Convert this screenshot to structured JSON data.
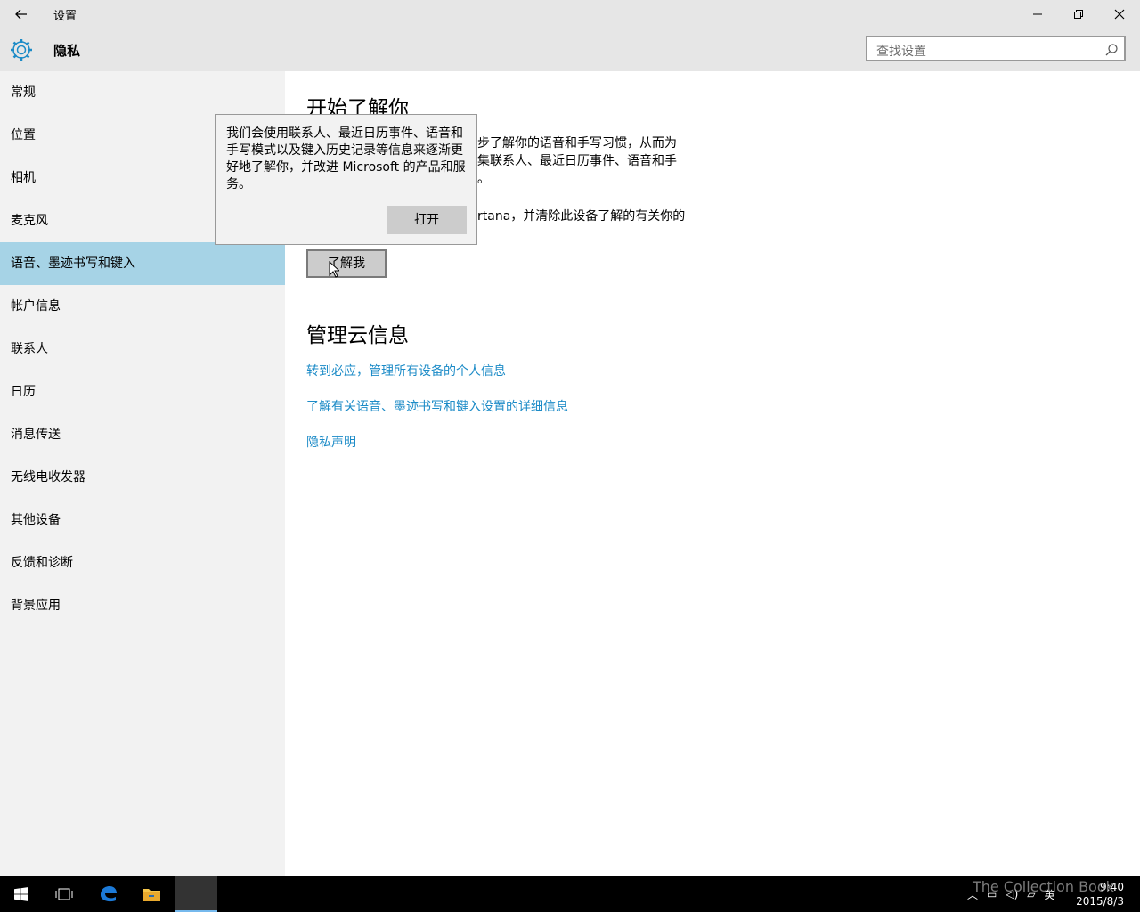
{
  "window": {
    "title": "设置",
    "header_title": "隐私",
    "search_placeholder": "查找设置"
  },
  "sidebar": {
    "items": [
      {
        "label": "常规"
      },
      {
        "label": "位置"
      },
      {
        "label": "相机"
      },
      {
        "label": "麦克风"
      },
      {
        "label": "语音、墨迹书写和键入",
        "active": true
      },
      {
        "label": "帐户信息"
      },
      {
        "label": "联系人"
      },
      {
        "label": "日历"
      },
      {
        "label": "消息传送"
      },
      {
        "label": "无线电收发器"
      },
      {
        "label": "其他设备"
      },
      {
        "label": "反馈和诊断"
      },
      {
        "label": "背景应用"
      }
    ]
  },
  "main": {
    "section1_title": "开始了解你",
    "para1_line1": "步了解你的语音和手写习惯，从而为",
    "para1_line2": "集联系人、最近日历事件、语音和手",
    "para1_line3": "。",
    "para2": "rtana，并清除此设备了解的有关你的",
    "know_me_button": "了解我",
    "section2_title": "管理云信息",
    "links": [
      "转到必应，管理所有设备的个人信息",
      "了解有关语音、墨迹书写和键入设置的详细信息",
      "隐私声明"
    ]
  },
  "popup": {
    "text": "我们会使用联系人、最近日历事件、语音和手写模式以及键入历史记录等信息来逐渐更好地了解你，并改进 Microsoft 的产品和服务。",
    "open_button": "打开"
  },
  "taskbar": {
    "clock_time": "9:40",
    "clock_date": "2015/8/3",
    "input_lang": "英"
  },
  "watermark": "The Collection Book",
  "colors": {
    "accent_selected": "#a6d3e6",
    "link": "#1c8bc7",
    "taskbar": "#000000"
  }
}
